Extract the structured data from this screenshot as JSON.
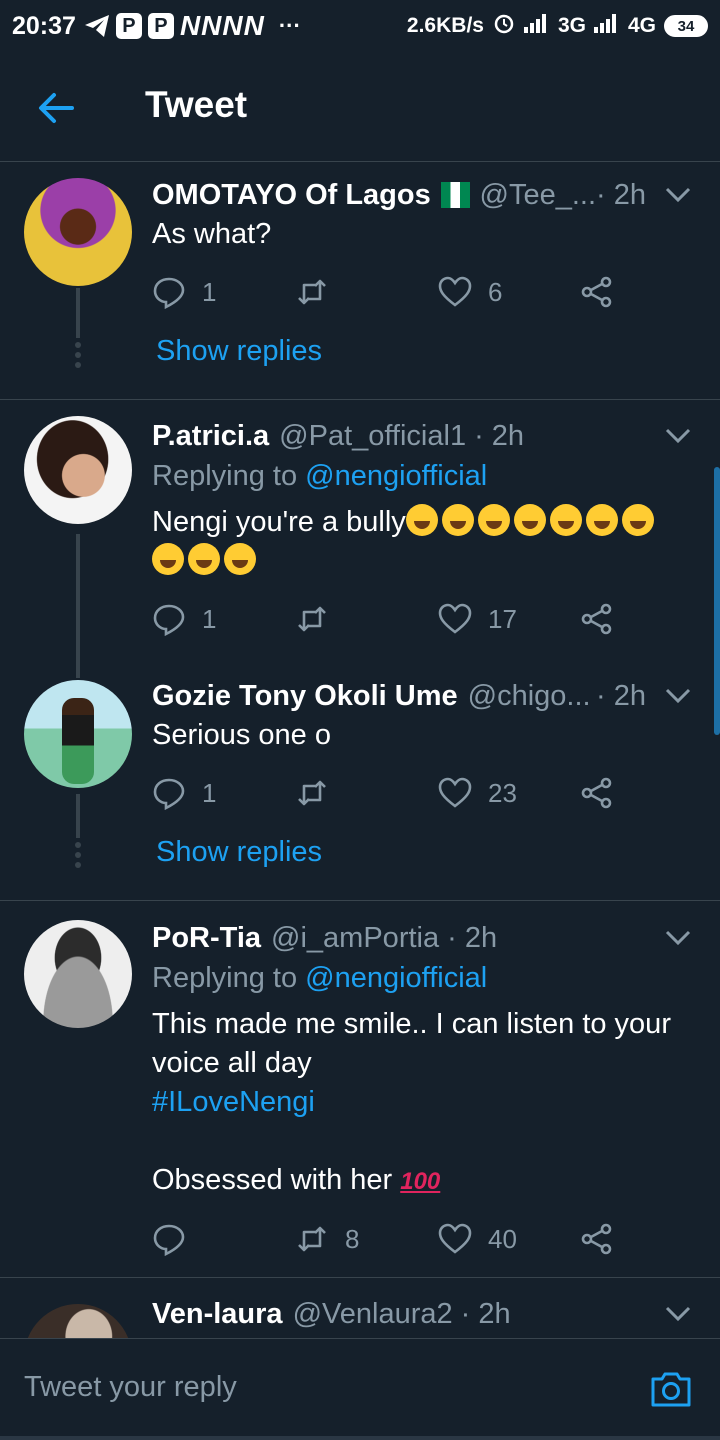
{
  "status_bar": {
    "time": "20:37",
    "n_icons": "NNNN",
    "dots": "···",
    "speed": "2.6KB/s",
    "net1": "3G",
    "net2": "4G",
    "battery": "34"
  },
  "header": {
    "title": "Tweet"
  },
  "tweets": [
    {
      "name": "OMOTAYO Of Lagos",
      "handle": "@Tee_...",
      "time": "· 2h",
      "text": "As what?",
      "replies": "1",
      "retweets": "",
      "likes": "6",
      "show_replies": "Show replies"
    },
    {
      "name": "P.atrici.a",
      "handle": "@Pat_official1",
      "time": "· 2h",
      "replying_prefix": "Replying to",
      "replying_to": "@nengiofficial",
      "text": "Nengi you're a bully",
      "replies": "1",
      "retweets": "",
      "likes": "17"
    },
    {
      "name": "Gozie Tony Okoli Ume",
      "handle": "@chigo...",
      "time": "· 2h",
      "text": "Serious one o",
      "replies": "1",
      "retweets": "",
      "likes": "23",
      "show_replies": "Show replies"
    },
    {
      "name": "PoR-Tia",
      "handle": "@i_amPortia",
      "time": "· 2h",
      "replying_prefix": "Replying to",
      "replying_to": "@nengiofficial",
      "text_line1": "This made me smile..  I can listen to your",
      "text_line2": "voice all day",
      "hashtag": "#ILoveNengi",
      "text_line3": "Obsessed with her",
      "emoji_100": "100",
      "replies": "",
      "retweets": "8",
      "likes": "40"
    },
    {
      "name": "Ven-laura",
      "handle": "@Venlaura2",
      "time": "· 2h"
    }
  ],
  "reply_bar": {
    "placeholder": "Tweet your reply"
  },
  "colors": {
    "background": "#15202b",
    "accent": "#1da1f2",
    "muted": "#8899a6",
    "border": "#38444d"
  }
}
